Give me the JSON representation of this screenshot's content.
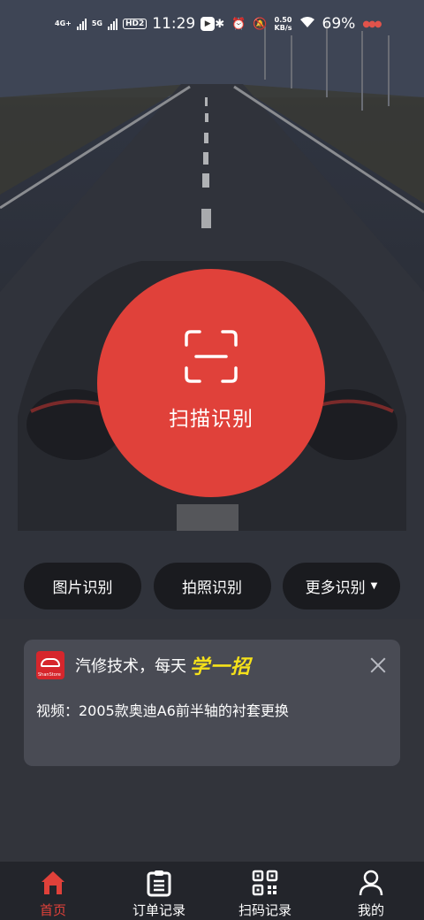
{
  "status_bar": {
    "net1": "4G+",
    "net2": "5G",
    "hd": "HD2",
    "time": "11:29",
    "speed_value": "0.50",
    "speed_unit": "KB/s",
    "battery": "69%",
    "icons": [
      "bluetooth-icon",
      "alarm-icon",
      "mute-icon",
      "wifi-icon"
    ]
  },
  "scan": {
    "label": "扫描识别",
    "icon": "scan-frame-icon",
    "color": "#e0413a"
  },
  "quick_actions": [
    {
      "label": "图片识别"
    },
    {
      "label": "拍照识别"
    },
    {
      "label": "更多识别",
      "dropdown": true
    }
  ],
  "notice": {
    "title": "汽修技术，每天",
    "highlight": "学一招",
    "body": "视频：2005款奥迪A6前半轴的衬套更换",
    "logo_text": "ShanStore",
    "highlight_color": "#f5e11a"
  },
  "bottom_nav": {
    "items": [
      {
        "label": "首页",
        "icon": "home-icon",
        "active": true
      },
      {
        "label": "订单记录",
        "icon": "clipboard-icon",
        "active": false
      },
      {
        "label": "扫码记录",
        "icon": "qr-code-icon",
        "active": false
      },
      {
        "label": "我的",
        "icon": "user-icon",
        "active": false
      }
    ],
    "active_color": "#e0413a"
  }
}
